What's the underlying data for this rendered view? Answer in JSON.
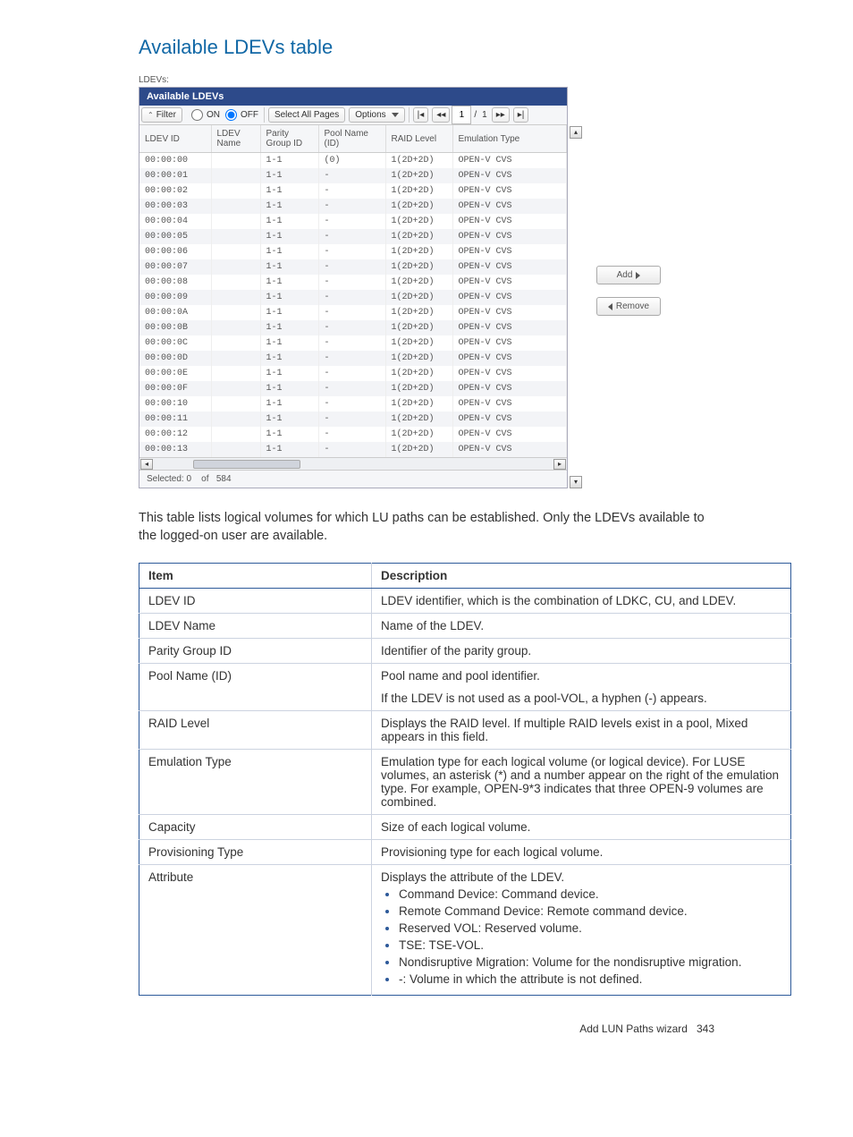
{
  "section_title": "Available LDEVs table",
  "ldevs_label": "LDEVs:",
  "panel": {
    "title": "Available LDEVs",
    "toolbar": {
      "filter_label": "Filter",
      "on_label": "ON",
      "off_label": "OFF",
      "select_all_label": "Select All Pages",
      "options_label": "Options",
      "page_current": "1",
      "page_sep": "/",
      "page_total": "1"
    },
    "columns": [
      "LDEV ID",
      "LDEV Name",
      "Parity Group ID",
      "Pool Name (ID)",
      "RAID Level",
      "Emulation Type"
    ],
    "rows": [
      {
        "id": "00:00:00",
        "name": "",
        "pg": "1-1",
        "pool": "(0)",
        "raid": "1(2D+2D)",
        "emu": "OPEN-V CVS"
      },
      {
        "id": "00:00:01",
        "name": "",
        "pg": "1-1",
        "pool": "-",
        "raid": "1(2D+2D)",
        "emu": "OPEN-V CVS"
      },
      {
        "id": "00:00:02",
        "name": "",
        "pg": "1-1",
        "pool": "-",
        "raid": "1(2D+2D)",
        "emu": "OPEN-V CVS"
      },
      {
        "id": "00:00:03",
        "name": "",
        "pg": "1-1",
        "pool": "-",
        "raid": "1(2D+2D)",
        "emu": "OPEN-V CVS"
      },
      {
        "id": "00:00:04",
        "name": "",
        "pg": "1-1",
        "pool": "-",
        "raid": "1(2D+2D)",
        "emu": "OPEN-V CVS"
      },
      {
        "id": "00:00:05",
        "name": "",
        "pg": "1-1",
        "pool": "-",
        "raid": "1(2D+2D)",
        "emu": "OPEN-V CVS"
      },
      {
        "id": "00:00:06",
        "name": "",
        "pg": "1-1",
        "pool": "-",
        "raid": "1(2D+2D)",
        "emu": "OPEN-V CVS"
      },
      {
        "id": "00:00:07",
        "name": "",
        "pg": "1-1",
        "pool": "-",
        "raid": "1(2D+2D)",
        "emu": "OPEN-V CVS"
      },
      {
        "id": "00:00:08",
        "name": "",
        "pg": "1-1",
        "pool": "-",
        "raid": "1(2D+2D)",
        "emu": "OPEN-V CVS"
      },
      {
        "id": "00:00:09",
        "name": "",
        "pg": "1-1",
        "pool": "-",
        "raid": "1(2D+2D)",
        "emu": "OPEN-V CVS"
      },
      {
        "id": "00:00:0A",
        "name": "",
        "pg": "1-1",
        "pool": "-",
        "raid": "1(2D+2D)",
        "emu": "OPEN-V CVS"
      },
      {
        "id": "00:00:0B",
        "name": "",
        "pg": "1-1",
        "pool": "-",
        "raid": "1(2D+2D)",
        "emu": "OPEN-V CVS"
      },
      {
        "id": "00:00:0C",
        "name": "",
        "pg": "1-1",
        "pool": "-",
        "raid": "1(2D+2D)",
        "emu": "OPEN-V CVS"
      },
      {
        "id": "00:00:0D",
        "name": "",
        "pg": "1-1",
        "pool": "-",
        "raid": "1(2D+2D)",
        "emu": "OPEN-V CVS"
      },
      {
        "id": "00:00:0E",
        "name": "",
        "pg": "1-1",
        "pool": "-",
        "raid": "1(2D+2D)",
        "emu": "OPEN-V CVS"
      },
      {
        "id": "00:00:0F",
        "name": "",
        "pg": "1-1",
        "pool": "-",
        "raid": "1(2D+2D)",
        "emu": "OPEN-V CVS"
      },
      {
        "id": "00:00:10",
        "name": "",
        "pg": "1-1",
        "pool": "-",
        "raid": "1(2D+2D)",
        "emu": "OPEN-V CVS"
      },
      {
        "id": "00:00:11",
        "name": "",
        "pg": "1-1",
        "pool": "-",
        "raid": "1(2D+2D)",
        "emu": "OPEN-V CVS"
      },
      {
        "id": "00:00:12",
        "name": "",
        "pg": "1-1",
        "pool": "-",
        "raid": "1(2D+2D)",
        "emu": "OPEN-V CVS"
      },
      {
        "id": "00:00:13",
        "name": "",
        "pg": "1-1",
        "pool": "-",
        "raid": "1(2D+2D)",
        "emu": "OPEN-V CVS"
      }
    ],
    "footer": {
      "selected_label": "Selected:",
      "selected_count": "0",
      "of_label": "of",
      "total": "584"
    }
  },
  "side_buttons": {
    "add": "Add",
    "remove": "Remove"
  },
  "body_text": "This table lists logical volumes for which LU paths can be established. Only the LDEVs available to the logged-on user are available.",
  "desc_table": {
    "headers": [
      "Item",
      "Description"
    ],
    "rows": [
      {
        "item": "LDEV ID",
        "desc": "LDEV identifier, which is the combination of LDKC, CU, and LDEV."
      },
      {
        "item": "LDEV Name",
        "desc": "Name of the LDEV."
      },
      {
        "item": "Parity Group ID",
        "desc": "Identifier of the parity group."
      },
      {
        "item": "Pool Name (ID)",
        "desc_lines": [
          "Pool name and pool identifier.",
          "If the LDEV is not used as a pool-VOL, a hyphen (-) appears."
        ]
      },
      {
        "item": "RAID Level",
        "desc": "Displays the RAID level. If multiple RAID levels exist in a pool, Mixed appears in this field."
      },
      {
        "item": "Emulation Type",
        "desc": "Emulation type for each logical volume (or logical device). For LUSE volumes, an asterisk (*) and a number appear on the right of the emulation type. For example, OPEN-9*3 indicates that three OPEN-9 volumes are combined."
      },
      {
        "item": "Capacity",
        "desc": "Size of each logical volume."
      },
      {
        "item": "Provisioning Type",
        "desc": "Provisioning type for each logical volume."
      },
      {
        "item": "Attribute",
        "desc": "Displays the attribute of the LDEV.",
        "bullets": [
          "Command Device: Command device.",
          "Remote Command Device: Remote command device.",
          "Reserved VOL: Reserved volume.",
          "TSE: TSE-VOL.",
          "Nondisruptive Migration: Volume for the nondisruptive migration.",
          "-: Volume in which the attribute is not defined."
        ]
      }
    ]
  },
  "page_footer": {
    "text": "Add LUN Paths wizard",
    "page": "343"
  }
}
